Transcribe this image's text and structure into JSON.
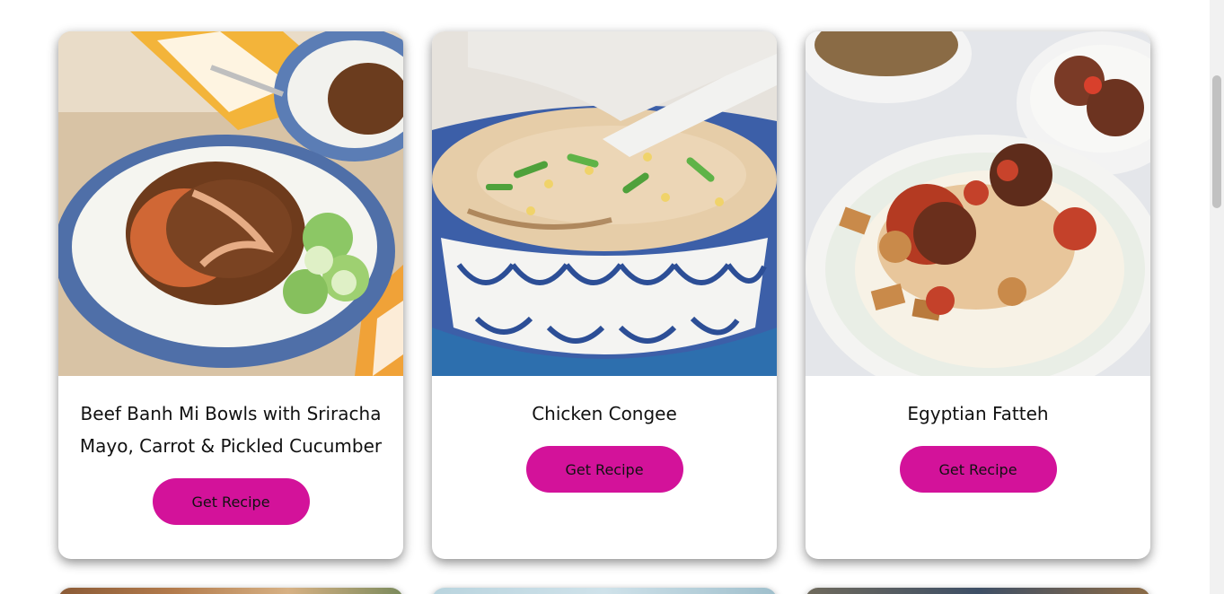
{
  "recipes": [
    {
      "title": "Beef Banh Mi Bowls with Sriracha Mayo, Carrot & Pickled Cucumber",
      "button_label": "Get Recipe"
    },
    {
      "title": "Chicken Congee",
      "button_label": "Get Recipe"
    },
    {
      "title": "Egyptian Fatteh",
      "button_label": "Get Recipe"
    }
  ],
  "colors": {
    "button": "#d3129a",
    "card_background": "#ffffff"
  }
}
